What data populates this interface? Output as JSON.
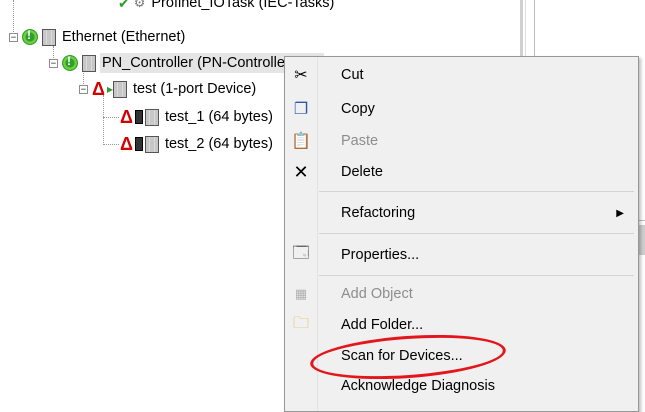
{
  "tree": {
    "nodes": [
      {
        "label": "Profinet_IOTask (IEC-Tasks)"
      },
      {
        "label": "Ethernet (Ethernet)"
      },
      {
        "label": "PN_Controller (PN-Controller)"
      },
      {
        "label": "test (1-port Device)"
      },
      {
        "label": "test_1 (64 bytes)"
      },
      {
        "label": "test_2 (64 bytes)"
      }
    ]
  },
  "context_menu": {
    "items": [
      {
        "label": "Cut",
        "icon": "scissors-icon",
        "enabled": true
      },
      {
        "label": "Copy",
        "icon": "copy-icon",
        "enabled": true
      },
      {
        "label": "Paste",
        "icon": "paste-icon",
        "enabled": false
      },
      {
        "label": "Delete",
        "icon": "x-icon",
        "enabled": true
      },
      {
        "label": "Refactoring",
        "icon": "",
        "enabled": true,
        "submenu": true
      },
      {
        "label": "Properties...",
        "icon": "properties-icon",
        "enabled": true
      },
      {
        "label": "Add Object",
        "icon": "add-object-icon",
        "enabled": false
      },
      {
        "label": "Add Folder...",
        "icon": "folder-icon",
        "enabled": true
      },
      {
        "label": "Scan for Devices...",
        "icon": "",
        "enabled": true,
        "highlighted_annotation": true
      },
      {
        "label": "Acknowledge Diagnosis",
        "icon": "",
        "enabled": true
      }
    ]
  },
  "colors": {
    "annotation": "#e3161b",
    "warning": "#d40000",
    "status_ok": "#2f9e2f"
  }
}
